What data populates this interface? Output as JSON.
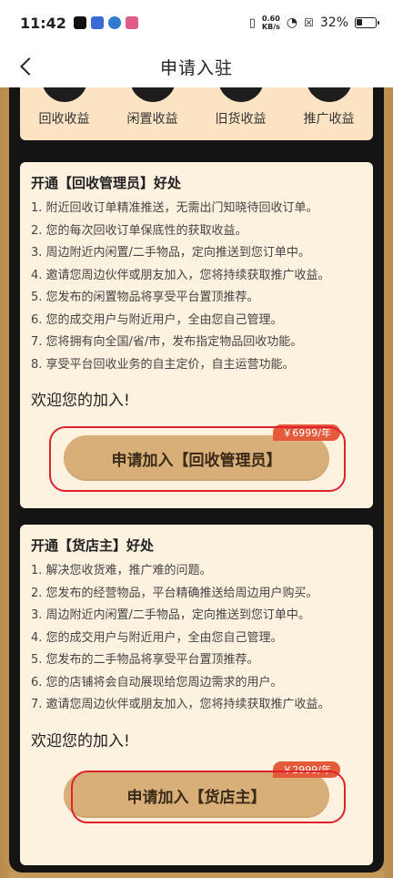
{
  "status_bar": {
    "time": "11:42",
    "net_speed_value": "0.60",
    "net_speed_unit": "KB/s",
    "battery_percent": "32%"
  },
  "nav": {
    "title": "申请入驻"
  },
  "categories": [
    {
      "label": "回收收益"
    },
    {
      "label": "闲置收益"
    },
    {
      "label": "旧货收益"
    },
    {
      "label": "推广收益"
    }
  ],
  "card_manager": {
    "title": "开通【回收管理员】好处",
    "benefits": [
      "1. 附近回收订单精准推送，无需出门知晓待回收订单。",
      "2. 您的每次回收订单保底性的获取收益。",
      "3. 周边附近内闲置/二手物品，定向推送到您订单中。",
      "4. 邀请您周边伙伴或朋友加入，您将持续获取推广收益。",
      "5. 您发布的闲置物品将享受平台置顶推荐。",
      "6. 您的成交用户与附近用户，全由您自己管理。",
      "7. 您将拥有向全国/省/市，发布指定物品回收功能。",
      "8. 享受平台回收业务的自主定价，自主运营功能。"
    ],
    "welcome": "欢迎您的加入!",
    "button_label": "申请加入【回收管理员】",
    "price": "￥6999/年"
  },
  "card_store": {
    "title": "开通【货店主】好处",
    "benefits": [
      "1. 解决您收货难，推广难的问题。",
      "2. 您发布的经营物品，平台精确推送给周边用户购买。",
      "3. 周边附近内闲置/二手物品，定向推送到您订单中。",
      "4. 您的成交用户与附近用户，全由您自己管理。",
      "5. 您发布的二手物品将享受平台置顶推荐。",
      "6. 您的店铺将会自动展现给您周边需求的用户。",
      "7. 邀请您周边伙伴或朋友加入，您将持续获取推广收益。"
    ],
    "welcome": "欢迎您的加入!",
    "button_label": "申请加入【货店主】",
    "price": "￥2999/年"
  },
  "colors": {
    "accent_button": "#d9af79",
    "card_bg": "#fdf1df",
    "price_tag": "#e45b3c",
    "highlight_ring": "#e0202a"
  }
}
